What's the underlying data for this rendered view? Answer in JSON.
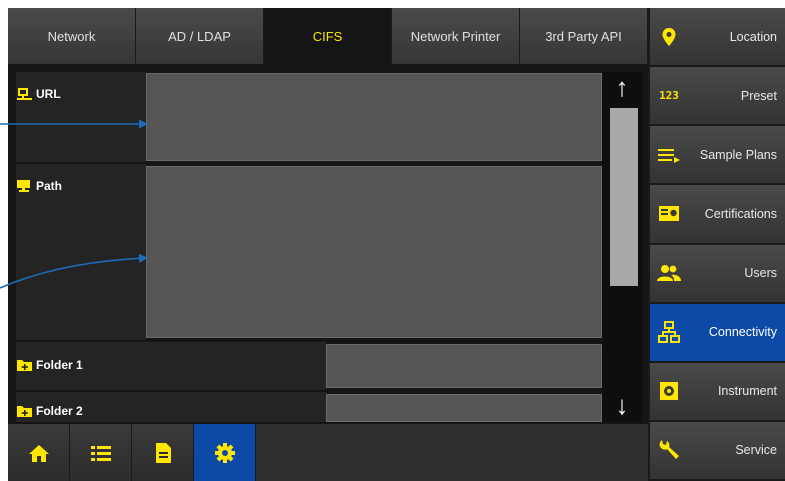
{
  "tabs": [
    {
      "label": "Network",
      "active": false
    },
    {
      "label": "AD / LDAP",
      "active": false
    },
    {
      "label": "CIFS",
      "active": true
    },
    {
      "label": "Network Printer",
      "active": false
    },
    {
      "label": "3rd Party API",
      "active": false
    }
  ],
  "fields": {
    "url": {
      "label": "URL",
      "value": ""
    },
    "path": {
      "label": "Path",
      "value": ""
    },
    "folder1": {
      "label": "Folder 1",
      "value": ""
    },
    "folder2": {
      "label": "Folder 2",
      "value": ""
    }
  },
  "scroll": {
    "up": "↑",
    "down": "↓"
  },
  "sidebar": [
    {
      "label": "Location",
      "icon": "location-pin-icon",
      "active": false
    },
    {
      "label": "Preset",
      "icon": "numbers-123-icon",
      "active": false
    },
    {
      "label": "Sample Plans",
      "icon": "list-arrow-icon",
      "active": false
    },
    {
      "label": "Certifications",
      "icon": "certificate-icon",
      "active": false
    },
    {
      "label": "Users",
      "icon": "users-icon",
      "active": false
    },
    {
      "label": "Connectivity",
      "icon": "network-icon",
      "active": true
    },
    {
      "label": "Instrument",
      "icon": "instrument-icon",
      "active": false
    },
    {
      "label": "Service",
      "icon": "wrench-icon",
      "active": false
    }
  ],
  "bottom_nav": [
    {
      "icon": "home-icon",
      "active": false
    },
    {
      "icon": "list-icon",
      "active": false
    },
    {
      "icon": "document-icon",
      "active": false
    },
    {
      "icon": "gear-icon",
      "active": true
    }
  ],
  "preset_icon_text": "123",
  "colors": {
    "accent": "#ffe600",
    "active": "#0d4aa8",
    "annotation": "#1e6bb8"
  }
}
